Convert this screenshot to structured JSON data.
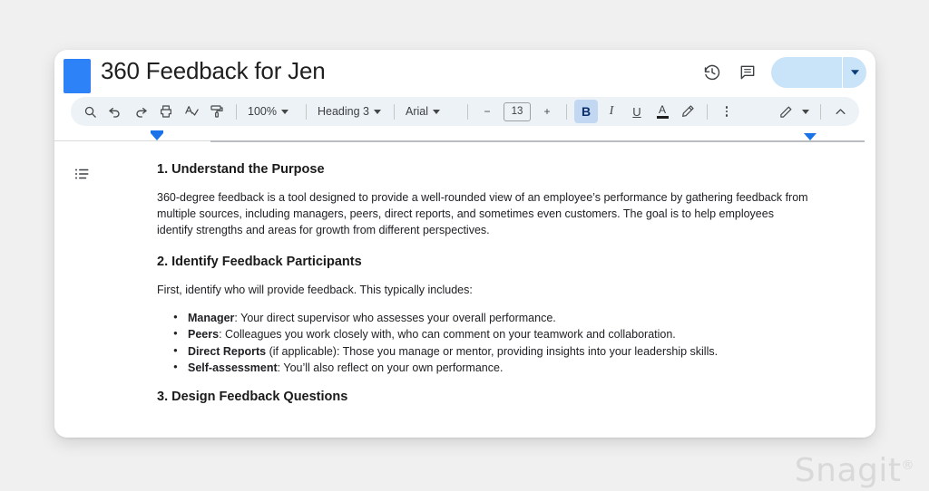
{
  "header": {
    "doc_title": "360 Feedback for Jen",
    "logo_color": "#2c82f6",
    "version_history_icon": "history-clock-icon",
    "comment_icon": "comment-icon",
    "share_label": "",
    "share_bg_color": "#c9e3f9"
  },
  "toolbar": {
    "search_icon": "search-icon",
    "undo_icon": "undo-icon",
    "redo_icon": "redo-icon",
    "print_icon": "print-icon",
    "spellcheck_icon": "spellcheck-icon",
    "paint_format_icon": "paint-format-icon",
    "zoom_value": "100%",
    "style_value": "Heading 3",
    "font_value": "Arial",
    "font_size_decrease": "−",
    "font_size_value": "13",
    "font_size_increase": "+",
    "bold_label": "B",
    "italic_label": "I",
    "underline_label": "U",
    "text_color_label": "A",
    "highlight_icon": "highlight-pen-icon",
    "more_options_icon": "more-vertical-icon",
    "edit_mode_icon": "pencil-icon",
    "collapse_icon": "chevron-up-icon",
    "bold_active": true,
    "active_bg_color": "#c2d7f2"
  },
  "ruler": {
    "left_indent_marker": "indent-marker-left",
    "right_indent_marker": "indent-marker-right"
  },
  "document": {
    "outline_icon": "document-outline-icon",
    "section1": {
      "heading": "1. Understand the Purpose",
      "paragraph": "360-degree feedback is a tool designed to provide a well-rounded view of an employee’s performance by gathering feedback from multiple sources, including managers, peers, direct reports, and sometimes even customers. The goal is to help employees identify strengths and areas for growth from different perspectives."
    },
    "section2": {
      "heading": "2. Identify Feedback Participants",
      "paragraph": "First, identify who will provide feedback. This typically includes:",
      "bullets": [
        {
          "bold": "Manager",
          "rest": ": Your direct supervisor who assesses your overall performance."
        },
        {
          "bold": "Peers",
          "rest": ": Colleagues you work closely with, who can comment on your teamwork and collaboration."
        },
        {
          "bold": "Direct Reports",
          "rest": " (if applicable): Those you manage or mentor, providing insights into your leadership skills."
        },
        {
          "bold": "Self-assessment",
          "rest": ": You’ll also reflect on your own performance."
        }
      ]
    },
    "section3": {
      "heading": "3. Design Feedback Questions"
    }
  },
  "watermark": {
    "text": "Snagit",
    "registered": "®"
  }
}
